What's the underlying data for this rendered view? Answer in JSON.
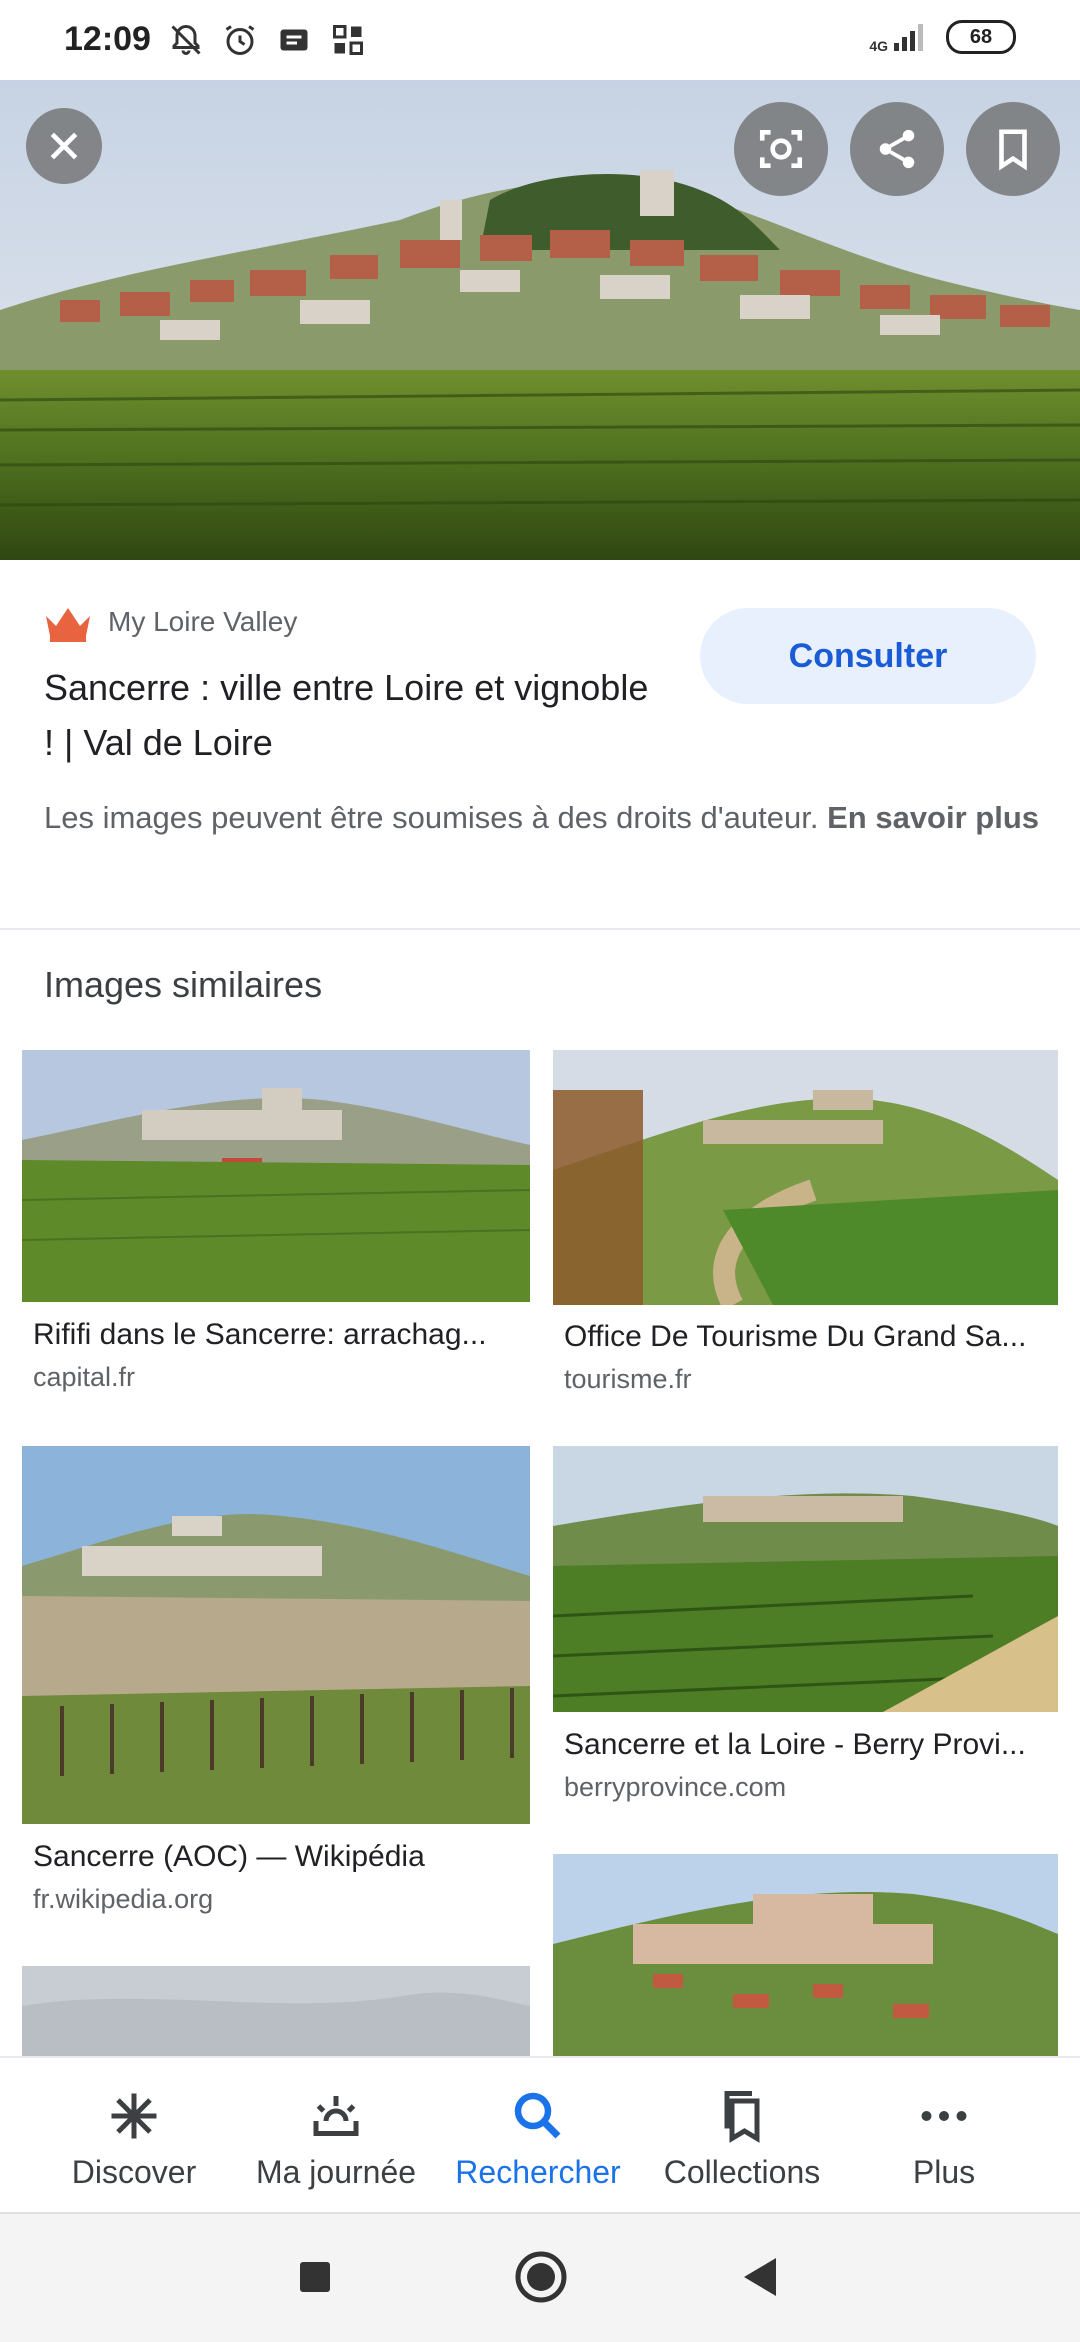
{
  "status_bar": {
    "time": "12:09",
    "network": "4G",
    "battery": "68"
  },
  "source": {
    "name": "My Loire Valley",
    "title": "Sancerre : ville entre Loire et vignoble ! | Val de Loire",
    "visit_label": "Consulter",
    "copyright_note": "Les images peuvent être soumises à des droits d'auteur.",
    "learn_more": "En savoir plus"
  },
  "similar": {
    "heading": "Images similaires",
    "items": [
      {
        "title": "Rififi dans le Sancerre: arrachag...",
        "site": "capital.fr"
      },
      {
        "title": "Office De Tourisme Du Grand Sa...",
        "site": "tourisme.fr"
      },
      {
        "title": "Sancerre (AOC) — Wikipédia",
        "site": "fr.wikipedia.org"
      },
      {
        "title": "Sancerre et la Loire - Berry Provi...",
        "site": "berryprovince.com"
      }
    ]
  },
  "bottom_nav": {
    "items": [
      {
        "label": "Discover",
        "icon": "asterisk-icon"
      },
      {
        "label": "Ma journée",
        "icon": "sunrise-icon"
      },
      {
        "label": "Rechercher",
        "icon": "search-icon"
      },
      {
        "label": "Collections",
        "icon": "bookmarks-icon"
      },
      {
        "label": "Plus",
        "icon": "more-horiz-icon"
      }
    ],
    "active": "Rechercher"
  },
  "colors": {
    "accent": "#1a73e8",
    "button_bg": "#e8f0fe",
    "text": "#202124",
    "muted": "#5f6368"
  }
}
